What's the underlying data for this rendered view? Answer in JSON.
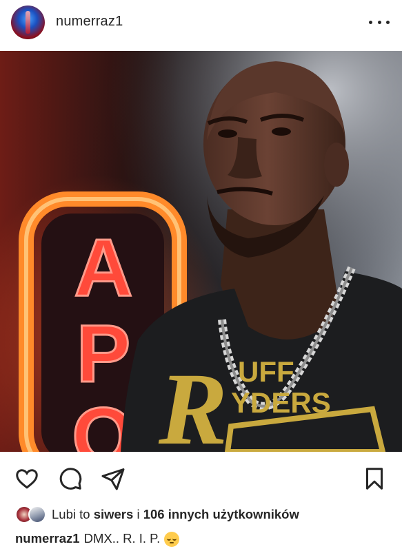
{
  "post": {
    "username": "numerraz1",
    "avatar_icon": "profile-avatar",
    "more_icon": "more-options-icon"
  },
  "photo": {
    "sign_letters": [
      "A",
      "P",
      "O"
    ],
    "shirt_text_line1": "UFF",
    "shirt_text_line2": "YDERS",
    "shirt_logo_letter": "R",
    "colors": {
      "neon": "#ff4a3a",
      "sign_frame": "#ff8a2a",
      "shirt_gold": "#c9a93e",
      "shirt": "#1c1d1f"
    }
  },
  "actions": {
    "like_icon": "heart-icon",
    "comment_icon": "comment-icon",
    "share_icon": "send-icon",
    "save_icon": "bookmark-icon"
  },
  "likes": {
    "prefix": "Lubi to",
    "user": "siwers",
    "connector": "i",
    "others": "106 innych użytkowników"
  },
  "caption": {
    "username": "numerraz1",
    "text": "DMX.. R. I. P.",
    "emoji": "pensive-face"
  }
}
